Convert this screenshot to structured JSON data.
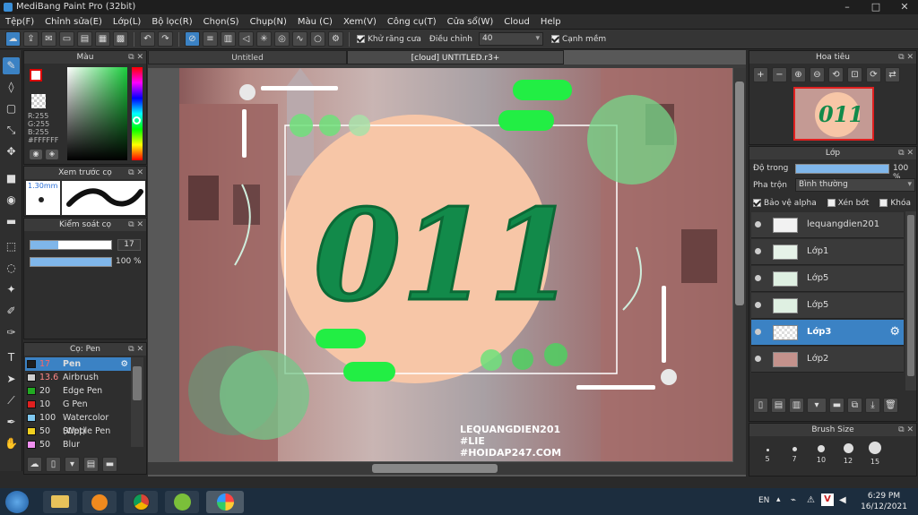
{
  "window": {
    "title": "MediBang Paint Pro (32bit)"
  },
  "menu": [
    "Tệp(F)",
    "Chỉnh sửa(E)",
    "Lớp(L)",
    "Bộ lọc(R)",
    "Chọn(S)",
    "Chụp(N)",
    "Màu (C)",
    "Xem(V)",
    "Công cụ(T)",
    "Cửa sổ(W)",
    "Cloud",
    "Help"
  ],
  "toolbar": {
    "antialias_label": "Khử răng cưa",
    "adjust_label": "Điều chỉnh",
    "adjust_value": "40",
    "sharp_label": "Cạnh mềm"
  },
  "tabs": [
    "Untitled",
    "[cloud] UNTITLED.r3+"
  ],
  "color_panel": {
    "title": "Màu",
    "r": "R:255",
    "g": "G:255",
    "b": "B:255",
    "hex": "#FFFFFF"
  },
  "brush_preview": {
    "title": "Xem trước cọ",
    "size": "1.30mm"
  },
  "brush_control": {
    "title": "Kiểm soát cọ",
    "size_value": "17",
    "opacity_value": "100 %"
  },
  "brush_list": {
    "title": "Cọ: Pen",
    "items": [
      {
        "size": "17",
        "name": "Pen",
        "color": "#1e1e1e"
      },
      {
        "size": "13.6",
        "name": "Airbrush",
        "color": "#cfcfcf"
      },
      {
        "size": "20",
        "name": "Edge Pen",
        "color": "#22aa22"
      },
      {
        "size": "10",
        "name": "G Pen",
        "color": "#e02020"
      },
      {
        "size": "100",
        "name": "Watercolor (Wet)",
        "color": "#7fc8f0"
      },
      {
        "size": "50",
        "name": "Stipple Pen",
        "color": "#f0d020"
      },
      {
        "size": "50",
        "name": "Blur",
        "color": "#f090f0"
      }
    ]
  },
  "navigator": {
    "title": "Hoa tiêu"
  },
  "layers": {
    "title": "Lớp",
    "opacity_label": "Độ trong",
    "opacity_value": "100 %",
    "blend_label": "Pha trộn",
    "blend_value": "Bình thường",
    "protect_alpha": "Bảo vệ alpha",
    "clipping": "Xén bớt",
    "lock": "Khóa",
    "items": [
      "lequangdien201",
      "Lớp1",
      "Lớp5",
      "Lớp5",
      "Lớp3",
      "Lớp2"
    ]
  },
  "brush_size": {
    "title": "Brush Size",
    "sizes": [
      "5",
      "7",
      "10",
      "12",
      "15"
    ]
  },
  "artwork": {
    "big_text": "011",
    "watermark": [
      "LEQUANGDIEN201",
      "#LIE",
      "#HOIDAP247.COM"
    ]
  },
  "taskbar": {
    "lang": "EN",
    "time": "6:29 PM",
    "date": "16/12/2021"
  },
  "colors": {
    "accent": "#3b82c4",
    "peach": "#f7c6a7",
    "green": "#128a4a",
    "neon": "#22ee44"
  }
}
